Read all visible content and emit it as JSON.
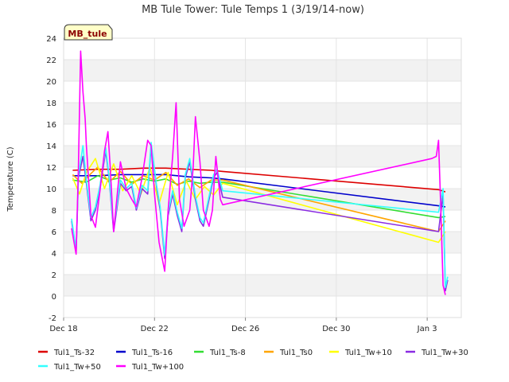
{
  "chart_data": {
    "type": "line",
    "title": "MB Tule Tower: Tule Temps 1 (3/19/14-now)",
    "xlabel": "",
    "ylabel": "Temperature (C)",
    "site_tag": "MB_tule",
    "xlim": [
      0,
      17.5
    ],
    "ylim": [
      -2,
      24
    ],
    "yticks": [
      -2,
      0,
      2,
      4,
      6,
      8,
      10,
      12,
      14,
      16,
      18,
      20,
      22,
      24
    ],
    "xticks": [
      {
        "x": 0,
        "label": "Dec 18"
      },
      {
        "x": 4,
        "label": "Dec 22"
      },
      {
        "x": 8,
        "label": "Dec 26"
      },
      {
        "x": 12,
        "label": "Dec 30"
      },
      {
        "x": 16,
        "label": "Jan 3"
      }
    ],
    "grid": true,
    "legend_position": "bottom",
    "series": [
      {
        "name": "Tul1_Ts-32",
        "color": "#dd0000",
        "x": [
          0.4,
          1.5,
          2.5,
          3.5,
          4.5,
          5.5,
          6.5,
          7.0,
          16.5,
          16.8
        ],
        "y": [
          11.7,
          11.8,
          11.8,
          11.9,
          11.9,
          11.8,
          11.7,
          11.6,
          9.9,
          9.7
        ]
      },
      {
        "name": "Tul1_Ts-16",
        "color": "#0000cc",
        "x": [
          0.4,
          1.5,
          2.5,
          3.5,
          4.5,
          5.5,
          6.5,
          7.0,
          16.5,
          16.8
        ],
        "y": [
          11.2,
          11.2,
          11.3,
          11.3,
          11.3,
          11.1,
          11.0,
          10.9,
          8.4,
          8.3
        ]
      },
      {
        "name": "Tul1_Ts-8",
        "color": "#33dd33",
        "x": [
          0.4,
          1.0,
          1.5,
          2.0,
          2.5,
          3.0,
          3.5,
          4.0,
          4.5,
          5.0,
          5.5,
          6.0,
          6.5,
          7.0,
          16.5,
          16.8
        ],
        "y": [
          10.8,
          10.6,
          11.2,
          10.8,
          11.0,
          10.6,
          10.9,
          10.7,
          10.9,
          10.4,
          10.7,
          10.5,
          10.6,
          10.6,
          7.3,
          7.4
        ]
      },
      {
        "name": "Tul1_Ts0",
        "color": "#ffa500",
        "x": [
          0.4,
          0.8,
          1.2,
          1.5,
          2.0,
          2.5,
          3.0,
          3.5,
          4.0,
          4.5,
          5.0,
          5.5,
          6.0,
          6.5,
          7.0,
          16.5,
          16.8
        ],
        "y": [
          11.3,
          10.5,
          11.4,
          12.0,
          10.6,
          11.6,
          10.4,
          11.2,
          10.8,
          11.5,
          10.3,
          10.9,
          10.1,
          10.8,
          10.8,
          6.0,
          7.0
        ]
      },
      {
        "name": "Tul1_Tw+10",
        "color": "#ffff00",
        "x": [
          0.4,
          0.7,
          1.0,
          1.4,
          1.8,
          2.2,
          2.6,
          3.0,
          3.4,
          3.8,
          4.2,
          4.6,
          5.0,
          5.4,
          5.8,
          6.2,
          6.6,
          7.0,
          16.5,
          16.8
        ],
        "y": [
          11.0,
          9.5,
          11.5,
          12.8,
          10.0,
          12.3,
          9.8,
          11.2,
          9.5,
          12.0,
          8.6,
          11.5,
          8.5,
          10.7,
          9.0,
          10.2,
          9.4,
          10.5,
          5.0,
          6.0
        ]
      },
      {
        "name": "Tul1_Tw+30",
        "color": "#8a2be2",
        "x": [
          0.35,
          0.55,
          0.65,
          0.85,
          1.0,
          1.2,
          1.4,
          1.6,
          1.85,
          2.0,
          2.2,
          2.5,
          2.75,
          3.0,
          3.2,
          3.45,
          3.7,
          3.85,
          4.1,
          4.25,
          4.45,
          4.6,
          4.8,
          5.0,
          5.2,
          5.35,
          5.55,
          5.8,
          6.0,
          6.15,
          6.4,
          6.6,
          6.75,
          7.0,
          16.5,
          16.7,
          16.8,
          16.9
        ],
        "y": [
          7.0,
          4.0,
          11.0,
          13.0,
          10.5,
          7.0,
          8.0,
          10.0,
          13.5,
          11.0,
          6.0,
          10.5,
          9.8,
          10.2,
          8.0,
          10.0,
          9.5,
          14.0,
          10.0,
          8.0,
          3.5,
          7.5,
          9.5,
          7.5,
          6.0,
          11.0,
          12.5,
          9.0,
          7.0,
          6.5,
          9.0,
          11.0,
          11.5,
          9.2,
          6.0,
          9.5,
          0.5,
          1.5
        ]
      },
      {
        "name": "Tul1_Tw+50",
        "color": "#33ffff",
        "x": [
          0.35,
          0.55,
          0.65,
          0.85,
          1.0,
          1.2,
          1.4,
          1.6,
          1.85,
          2.0,
          2.2,
          2.5,
          2.75,
          3.0,
          3.2,
          3.45,
          3.7,
          3.85,
          4.1,
          4.25,
          4.45,
          4.6,
          4.8,
          5.0,
          5.2,
          5.35,
          5.55,
          5.8,
          6.0,
          6.15,
          6.4,
          6.6,
          6.75,
          7.0,
          16.5,
          16.7,
          16.8,
          16.9
        ],
        "y": [
          7.2,
          4.3,
          11.2,
          14.0,
          10.8,
          7.3,
          8.3,
          10.3,
          13.8,
          11.2,
          6.3,
          10.8,
          10.0,
          10.5,
          8.2,
          10.3,
          9.8,
          14.3,
          10.2,
          8.3,
          3.8,
          7.8,
          9.8,
          7.8,
          6.3,
          11.3,
          12.8,
          9.3,
          7.3,
          6.8,
          9.3,
          11.3,
          11.8,
          9.8,
          7.8,
          10.0,
          0.8,
          1.8
        ]
      },
      {
        "name": "Tul1_Tw+100",
        "color": "#ff00ff",
        "x": [
          0.35,
          0.55,
          0.65,
          0.75,
          0.85,
          0.95,
          1.0,
          1.2,
          1.4,
          1.6,
          1.8,
          1.95,
          2.05,
          2.2,
          2.5,
          2.75,
          3.0,
          3.2,
          3.45,
          3.7,
          3.85,
          4.0,
          4.2,
          4.45,
          4.6,
          4.8,
          4.95,
          5.1,
          5.3,
          5.55,
          5.7,
          5.8,
          6.0,
          6.15,
          6.4,
          6.55,
          6.7,
          6.9,
          7.0,
          16.2,
          16.4,
          16.5,
          16.6,
          16.7,
          16.8
        ],
        "y": [
          6.3,
          3.9,
          12.0,
          22.8,
          19.0,
          16.5,
          14.0,
          7.5,
          6.4,
          9.8,
          13.5,
          15.3,
          12.0,
          6.0,
          12.5,
          10.0,
          9.0,
          8.3,
          11.0,
          14.5,
          14.0,
          9.5,
          5.0,
          2.3,
          8.0,
          13.0,
          18.0,
          9.0,
          6.5,
          8.0,
          12.0,
          16.7,
          12.5,
          8.0,
          6.5,
          8.0,
          13.0,
          9.0,
          8.5,
          12.8,
          13.0,
          14.5,
          8.0,
          1.0,
          0.1
        ]
      }
    ]
  }
}
